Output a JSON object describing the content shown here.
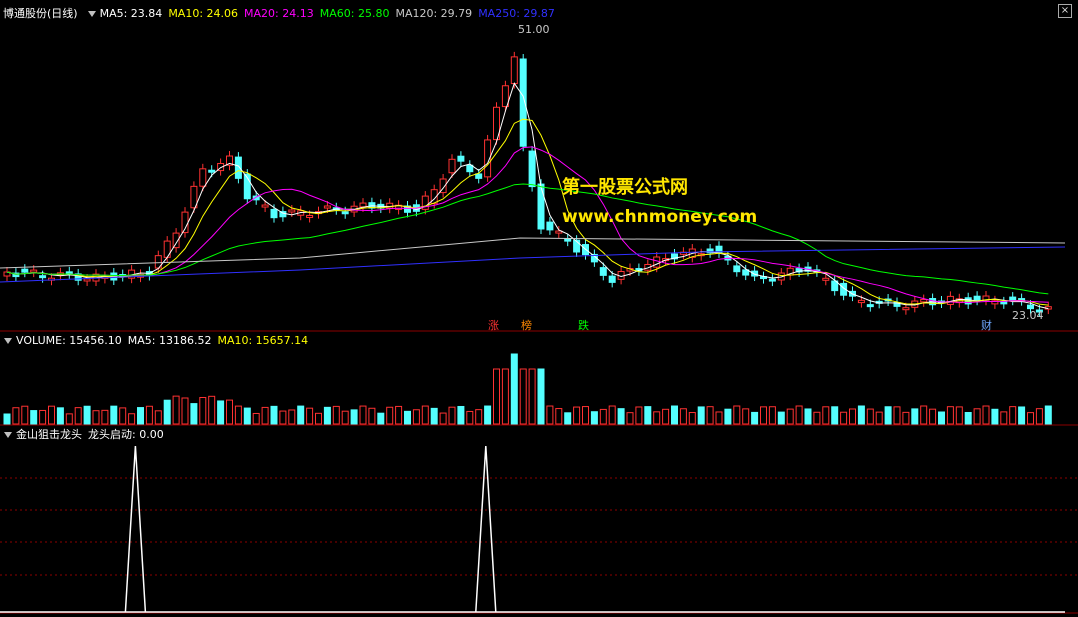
{
  "price_header": {
    "stock": "博通股份(日线)",
    "items": [
      {
        "text": "MA5: 23.84",
        "color": "#ffffff"
      },
      {
        "text": "MA10: 24.06",
        "color": "#ffff00"
      },
      {
        "text": "MA20: 24.13",
        "color": "#ff00ff"
      },
      {
        "text": "MA60: 25.80",
        "color": "#00ff00"
      },
      {
        "text": "MA120: 29.79",
        "color": "#c8c8c8"
      },
      {
        "text": "MA250: 29.87",
        "color": "#3030ff"
      }
    ]
  },
  "volume_header": {
    "items": [
      {
        "text": "VOLUME: 15456.10",
        "color": "#ffffff"
      },
      {
        "text": "MA5: 13186.52",
        "color": "#ffffff"
      },
      {
        "text": "MA10: 15657.14",
        "color": "#ffff00"
      }
    ]
  },
  "indicator_header": {
    "name": "金山狙击龙头",
    "items": [
      {
        "text": "龙头启动: 0.00",
        "color": "#ffffff"
      }
    ]
  },
  "annotations": {
    "high_label": "51.00",
    "last_label": "23.04",
    "tag_zhang": "涨",
    "tag_bang": "榜",
    "tag_die": "跌",
    "tag_cai": "财"
  },
  "watermark": {
    "line1": "第一股票公式网",
    "line2": "www.chnmoney.com"
  },
  "colors": {
    "up": "#ff3232",
    "down": "#54ffff",
    "ma5": "#ffffff",
    "ma10": "#ffff00",
    "ma20": "#ff00ff",
    "ma60": "#00ff00",
    "ma120": "#c8c8c8",
    "ma250": "#3030ff",
    "grid": "#8b0000",
    "signal": "#ffffff"
  },
  "signals": [
    {
      "bar_index": 18,
      "value": 1
    },
    {
      "bar_index": 66,
      "value": 1
    }
  ]
}
